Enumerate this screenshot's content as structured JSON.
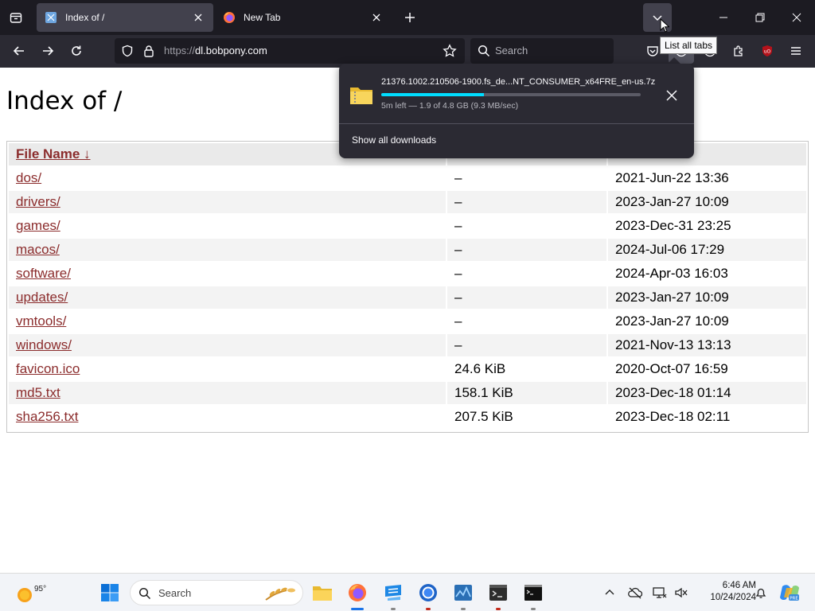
{
  "browser": {
    "tabs": [
      {
        "label": "Index of /",
        "active": true
      },
      {
        "label": "New Tab",
        "active": false
      }
    ],
    "url_prefix": "https://",
    "url_host": "dl.bobpony.com",
    "search_placeholder": "Search",
    "tooltip": "List all tabs"
  },
  "downloads_panel": {
    "filename": "21376.1002.210506-1900.fs_de...NT_CONSUMER_x64FRE_en-us.7z",
    "status": "5m left — 1.9 of 4.8 GB (9.3 MB/sec)",
    "progress_fraction": 0.3958,
    "show_all_label": "Show all downloads"
  },
  "page": {
    "title": "Index of /",
    "headers": {
      "name": "File Name  ↓"
    },
    "rows": [
      {
        "name": "dos/",
        "size": "–",
        "date": "2021-Jun-22 13:36"
      },
      {
        "name": "drivers/",
        "size": "–",
        "date": "2023-Jan-27 10:09"
      },
      {
        "name": "games/",
        "size": "–",
        "date": "2023-Dec-31 23:25"
      },
      {
        "name": "macos/",
        "size": "–",
        "date": "2024-Jul-06 17:29"
      },
      {
        "name": "software/",
        "size": "–",
        "date": "2024-Apr-03 16:03"
      },
      {
        "name": "updates/",
        "size": "–",
        "date": "2023-Jan-27 10:09"
      },
      {
        "name": "vmtools/",
        "size": "–",
        "date": "2023-Jan-27 10:09"
      },
      {
        "name": "windows/",
        "size": "–",
        "date": "2021-Nov-13 13:13"
      },
      {
        "name": "favicon.ico",
        "size": "24.6 KiB",
        "date": "2020-Oct-07 16:59"
      },
      {
        "name": "md5.txt",
        "size": "158.1 KiB",
        "date": "2023-Dec-18 01:14"
      },
      {
        "name": "sha256.txt",
        "size": "207.5 KiB",
        "date": "2023-Dec-18 02:11"
      }
    ]
  },
  "taskbar": {
    "weather_temp": "95°",
    "search_placeholder": "Search",
    "time": "6:46 AM",
    "date": "10/24/2024",
    "apps": [
      "file-explorer",
      "firefox",
      "remote-desktop",
      "chrome",
      "task-manager",
      "terminal",
      "cmd"
    ]
  },
  "colors": {
    "tabstrip": "#1c1b22",
    "toolbar": "#2b2a33",
    "link": "#8b2c2c",
    "progress": "#00ddff"
  }
}
